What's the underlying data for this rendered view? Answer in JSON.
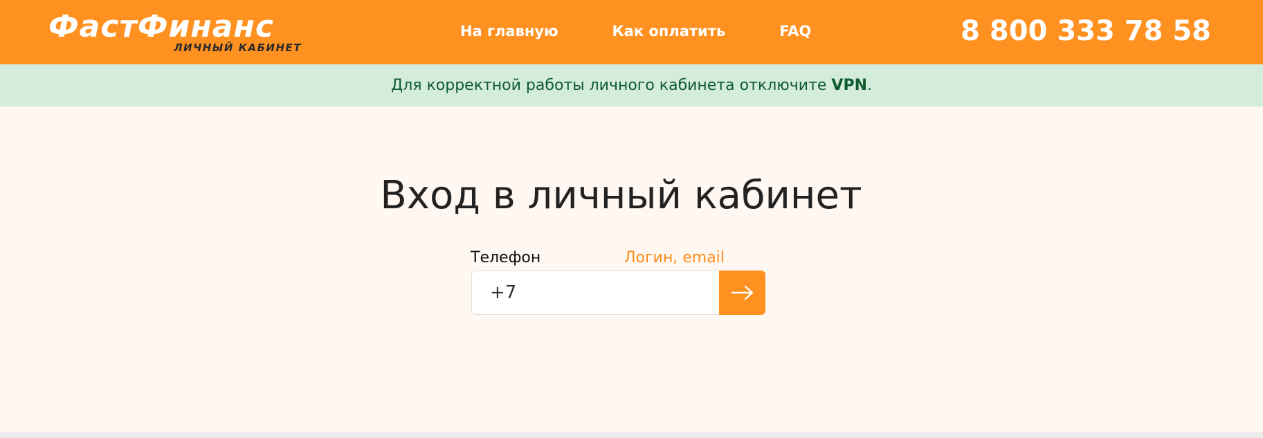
{
  "header": {
    "logo_main": "ФастФинанс",
    "logo_sub": "ЛИЧНЫЙ КАБИНЕТ",
    "nav": [
      "На главную",
      "Как оплатить",
      "FAQ"
    ],
    "phone": "8 800 333 78 58"
  },
  "notice": {
    "text": "Для корректной работы личного кабинета отключите ",
    "highlight": "VPN",
    "end": "."
  },
  "login": {
    "title": "Вход в личный кабинет",
    "tab_phone": "Телефон",
    "tab_login": "Логин, email",
    "phone_value": "+7",
    "submit_icon": "arrow-right-icon"
  },
  "colors": {
    "brand_orange": "#ff9121",
    "notice_bg": "#d4ecdc",
    "notice_text": "#0f5a2e",
    "page_bg": "#fff7f1"
  }
}
